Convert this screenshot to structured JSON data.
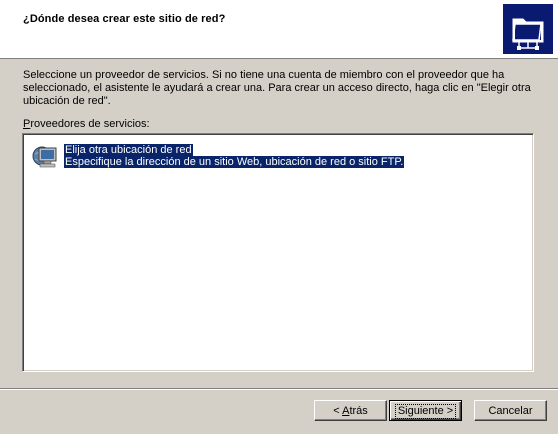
{
  "header": {
    "title": "¿Dónde desea crear este sitio de red?",
    "icon": "network-folder-icon"
  },
  "intro": {
    "text": "Seleccione un proveedor de servicios. Si no tiene una cuenta de miembro con el proveedor que ha seleccionado, el asistente le ayudará a crear una. Para crear un acceso directo, haga clic en \"Elegir otra ubicación de red\"."
  },
  "providers": {
    "label_hotkey": "P",
    "label_rest": "roveedores de servicios:",
    "items": [
      {
        "title": "Elija otra ubicación de red",
        "description": "Especifique la dirección de un sitio Web, ubicación de red o sitio FTP.",
        "icon": "network-computer-icon",
        "selected": true
      }
    ]
  },
  "buttons": {
    "back_prefix": "< ",
    "back_hotkey": "A",
    "back_rest": "trás",
    "next": "Siguiente >",
    "cancel": "Cancelar"
  },
  "colors": {
    "selection": "#0a246a",
    "dialog_face": "#d4d0c8",
    "icon_background": "#0a1a70"
  }
}
